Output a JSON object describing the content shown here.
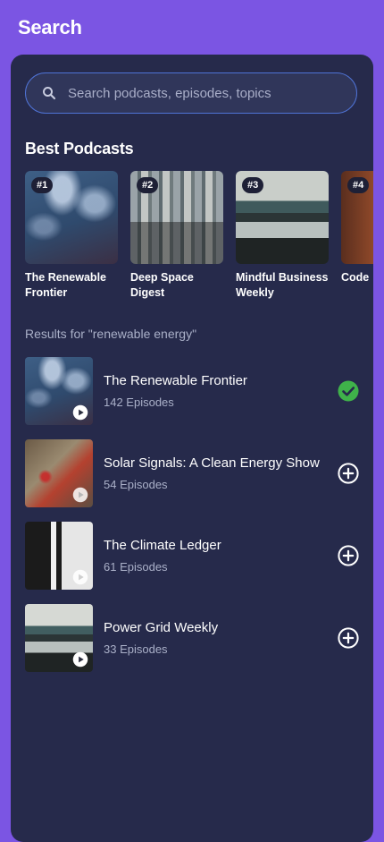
{
  "header": {
    "title": "Search"
  },
  "search": {
    "placeholder": "Search podcasts, episodes, topics",
    "value": ""
  },
  "best_podcasts": {
    "title": "Best Podcasts",
    "items": [
      {
        "rank": "#1",
        "title": "The Renewable Frontier",
        "image": "ocean-aerial"
      },
      {
        "rank": "#2",
        "title": "Deep Space Digest",
        "image": "city-rooftop-feet"
      },
      {
        "rank": "#3",
        "title": "Mindful Business Weekly",
        "image": "vintage-car-front"
      },
      {
        "rank": "#4",
        "title": "Code",
        "image": "brown-building"
      }
    ]
  },
  "results": {
    "label": "Results for \"renewable energy\"",
    "items": [
      {
        "title": "The Renewable Frontier",
        "count": "142 Episodes",
        "image": "ocean-aerial",
        "action": "check-circle-icon",
        "subscribed": true
      },
      {
        "title": "Solar Signals: A Clean Energy Show",
        "count": "54 Episodes",
        "image": "red-bicycle",
        "action": "add-circle-icon",
        "subscribed": false
      },
      {
        "title": "The Climate Ledger",
        "count": "61 Episodes",
        "image": "black-white-abstract",
        "action": "add-circle-icon",
        "subscribed": false
      },
      {
        "title": "Power Grid Weekly",
        "count": "33 Episodes",
        "image": "vintage-car-front",
        "action": "add-circle-icon",
        "subscribed": false
      }
    ]
  },
  "colors": {
    "background": "#7b55e3",
    "panel": "#262a4b",
    "search_border": "#4f73d6",
    "subscribed_green": "#3fb24a"
  }
}
